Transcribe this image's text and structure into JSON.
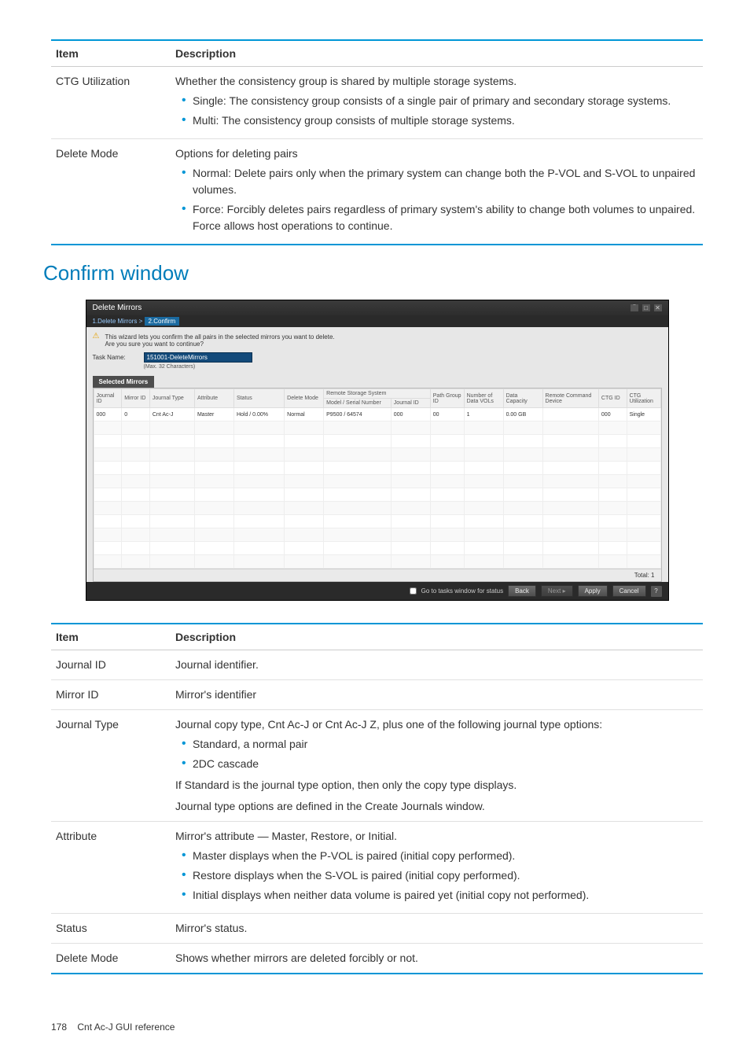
{
  "table1": {
    "head_item": "Item",
    "head_desc": "Description",
    "rows": [
      {
        "item": "CTG Utilization",
        "desc_lead": "Whether the consistency group is shared by multiple storage systems.",
        "bullets": [
          "Single: The consistency group consists of a single pair of primary and secondary storage systems.",
          "Multi: The consistency group consists of multiple storage systems."
        ]
      },
      {
        "item": "Delete Mode",
        "desc_lead": "Options for deleting pairs",
        "bullets": [
          "Normal: Delete pairs only when the primary system can change both the P-VOL and S-VOL to unpaired volumes.",
          "Force: Forcibly deletes pairs regardless of primary system's ability to change both volumes to unpaired. Force allows host operations to continue."
        ]
      }
    ]
  },
  "section_title": "Confirm window",
  "screenshot": {
    "title": "Delete Mirrors",
    "breadcrumb_step1": "1.Delete Mirrors",
    "breadcrumb_sep": "  >  ",
    "breadcrumb_step2": "2.Confirm",
    "warn_line1": "This wizard lets you confirm the all pairs in the selected mirrors you want to delete.",
    "warn_line2": "Are you sure you want to continue?",
    "task_name_label": "Task Name:",
    "task_name_value": "151001-DeleteMirrors",
    "task_name_hint": "(Max. 32 Characters)",
    "selected_mirrors_tab": "Selected Mirrors",
    "headers": {
      "journal_id": "Journal ID",
      "mirror_id": "Mirror ID",
      "journal_type": "Journal Type",
      "attribute": "Attribute",
      "status": "Status",
      "delete_mode": "Delete Mode",
      "remote_storage": "Remote Storage System",
      "model_serial": "Model / Serial Number",
      "remote_journal_id": "Journal ID",
      "path_group_id": "Path Group ID",
      "num_data_vols": "Number of Data VOLs",
      "data_capacity": "Data Capacity",
      "remote_cmd_device": "Remote Command Device",
      "ctg_id": "CTG ID",
      "ctg_util": "CTG Utilization"
    },
    "row0": {
      "journal_id": "000",
      "mirror_id": "0",
      "journal_type": "Cnt Ac-J",
      "attribute": "Master",
      "status": "Hold / 0.00%",
      "delete_mode": "Normal",
      "model_serial": "P9500 / 64574",
      "remote_journal_id": "000",
      "path_group_id": "00",
      "num_data_vols": "1",
      "data_capacity": "0.00 GB",
      "remote_cmd_device": "",
      "ctg_id": "000",
      "ctg_util": "Single"
    },
    "total_label": "Total: 1",
    "footer_checkbox": "Go to tasks window for status",
    "btn_back": "Back",
    "btn_next": "Next ▸",
    "btn_apply": "Apply",
    "btn_cancel": "Cancel",
    "btn_help": "?"
  },
  "table2": {
    "head_item": "Item",
    "head_desc": "Description",
    "r0_item": "Journal ID",
    "r0_desc": "Journal identifier.",
    "r1_item": "Mirror ID",
    "r1_desc": "Mirror's identifier",
    "r2_item": "Journal Type",
    "r2_lead": "Journal copy type, Cnt Ac-J or Cnt Ac-J Z, plus one of the following journal type options:",
    "r2_b1": "Standard, a normal pair",
    "r2_b2": "2DC cascade",
    "r2_tail1": "If Standard is the journal type option, then only the copy type displays.",
    "r2_tail2": "Journal type options are defined in the Create Journals window.",
    "r3_item": "Attribute",
    "r3_lead": "Mirror's attribute — Master, Restore, or Initial.",
    "r3_b1": "Master displays when the P-VOL is paired (initial copy performed).",
    "r3_b2": "Restore displays when the S-VOL is paired (initial copy performed).",
    "r3_b3": "Initial displays when neither data volume is paired yet (initial copy not performed).",
    "r4_item": "Status",
    "r4_desc": "Mirror's status.",
    "r5_item": "Delete Mode",
    "r5_desc": "Shows whether mirrors are deleted forcibly or not."
  },
  "footer": {
    "page": "178",
    "title": "Cnt Ac-J GUI reference"
  }
}
